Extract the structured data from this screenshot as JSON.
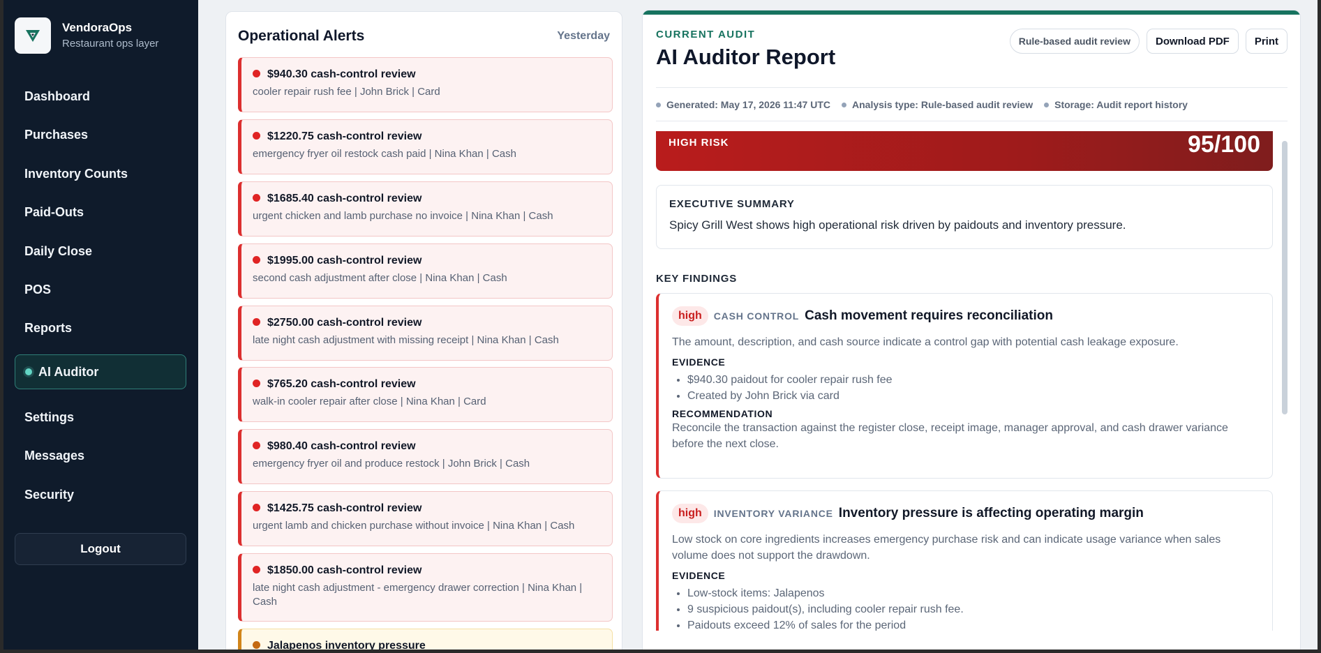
{
  "app": {
    "name": "VendoraOps",
    "tagline": "Restaurant ops layer",
    "brand_color": "#17735f"
  },
  "sidebar": {
    "items": [
      {
        "label": "Dashboard"
      },
      {
        "label": "Purchases"
      },
      {
        "label": "Inventory Counts"
      },
      {
        "label": "Paid-Outs"
      },
      {
        "label": "Daily Close"
      },
      {
        "label": "POS"
      },
      {
        "label": "Reports"
      },
      {
        "label": "AI Auditor",
        "active": true
      },
      {
        "label": "Settings"
      },
      {
        "label": "Messages"
      },
      {
        "label": "Security"
      }
    ],
    "logout_label": "Logout"
  },
  "alerts": {
    "title": "Operational Alerts",
    "date": "Yesterday",
    "items": [
      {
        "title": "$940.30 cash-control review",
        "desc": "cooler repair rush fee | John Brick | Card",
        "level": "critical"
      },
      {
        "title": "$1220.75 cash-control review",
        "desc": "emergency fryer oil restock cash paid | Nina Khan | Cash",
        "level": "critical"
      },
      {
        "title": "$1685.40 cash-control review",
        "desc": "urgent chicken and lamb purchase no invoice | Nina Khan | Cash",
        "level": "critical"
      },
      {
        "title": "$1995.00 cash-control review",
        "desc": "second cash adjustment after close | Nina Khan | Cash",
        "level": "critical"
      },
      {
        "title": "$2750.00 cash-control review",
        "desc": "late night cash adjustment with missing receipt | Nina Khan | Cash",
        "level": "critical"
      },
      {
        "title": "$765.20 cash-control review",
        "desc": "walk-in cooler repair after close | Nina Khan | Card",
        "level": "critical"
      },
      {
        "title": "$980.40 cash-control review",
        "desc": "emergency fryer oil and produce restock | John Brick | Cash",
        "level": "critical"
      },
      {
        "title": "$1425.75 cash-control review",
        "desc": "urgent lamb and chicken purchase without invoice | Nina Khan | Cash",
        "level": "critical"
      },
      {
        "title": "$1850.00 cash-control review",
        "desc": "late night cash adjustment - emergency drawer correction | Nina Khan | Cash",
        "level": "critical"
      },
      {
        "title": "Jalapenos inventory pressure",
        "desc": "",
        "level": "warning"
      }
    ]
  },
  "report": {
    "eyebrow": "CURRENT AUDIT",
    "title": "AI Auditor Report",
    "actions": {
      "review_badge": "Rule-based audit review",
      "download_label": "Download PDF",
      "print_label": "Print"
    },
    "meta": {
      "generated": "Generated: May 17, 2026 11:47 UTC",
      "analysis_type": "Analysis type: Rule-based audit review",
      "storage": "Storage: Audit report history"
    },
    "risk": {
      "label": "HIGH RISK",
      "score": "95/100",
      "color": "#b91c1c"
    },
    "summary": {
      "label": "EXECUTIVE SUMMARY",
      "text": "Spicy Grill West shows high operational risk driven by paidouts and inventory pressure."
    },
    "key_findings_label": "KEY FINDINGS",
    "findings": [
      {
        "severity": "high",
        "category": "CASH CONTROL",
        "title": "Cash movement requires reconciliation",
        "desc": "The amount, description, and cash source indicate a control gap with potential cash leakage exposure.",
        "evidence_label": "EVIDENCE",
        "evidence": [
          "$940.30 paidout for cooler repair rush fee",
          "Created by John Brick via card"
        ],
        "recommendation_label": "RECOMMENDATION",
        "recommendation": "Reconcile the transaction against the register close, receipt image, manager approval, and cash drawer variance before the next close."
      },
      {
        "severity": "high",
        "category": "INVENTORY VARIANCE",
        "title": "Inventory pressure is affecting operating margin",
        "desc": "Low stock on core ingredients increases emergency purchase risk and can indicate usage variance when sales volume does not support the drawdown.",
        "evidence_label": "EVIDENCE",
        "evidence": [
          "Low-stock items: Jalapenos",
          "9 suspicious paidout(s), including cooler repair rush fee.",
          "Paidouts exceed 12% of sales for the period"
        ]
      }
    ]
  }
}
